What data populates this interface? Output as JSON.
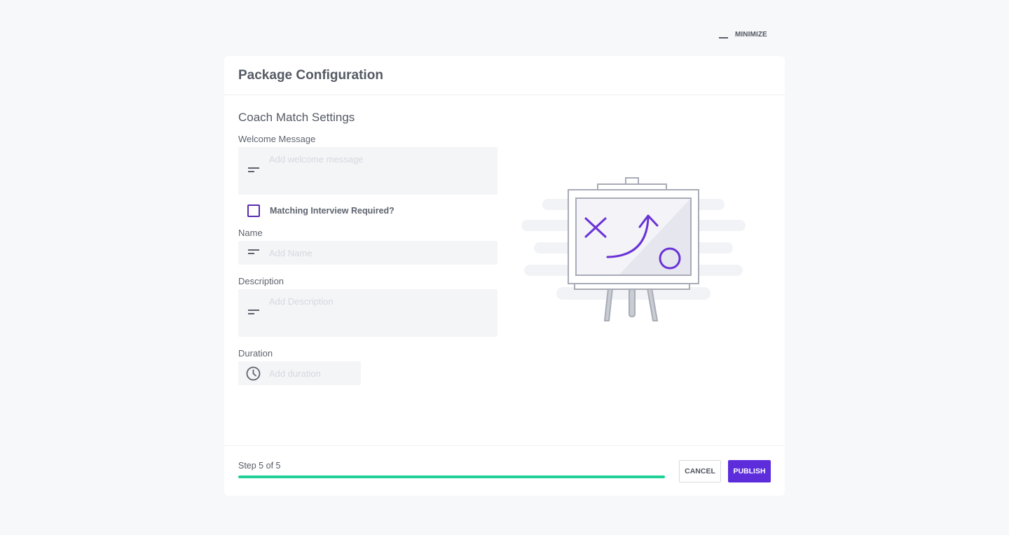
{
  "top_bar": {
    "minimize_label": "MINIMIZE"
  },
  "card": {
    "title": "Package Configuration",
    "section_title": "Coach Match Settings"
  },
  "form": {
    "welcome": {
      "label": "Welcome Message",
      "placeholder": "Add welcome message",
      "value": ""
    },
    "matching_interview": {
      "label": "Matching  Interview Required?",
      "checked": false
    },
    "name": {
      "label": "Name",
      "placeholder": "Add Name",
      "value": ""
    },
    "description": {
      "label": "Description",
      "placeholder": "Add Description",
      "value": ""
    },
    "duration": {
      "label": "Duration",
      "placeholder": "Add duration",
      "value": ""
    }
  },
  "illustration": {
    "icon": "strategy-board-illustration"
  },
  "footer": {
    "step_text": "Step 5 of 5",
    "progress": 1.0,
    "cancel_label": "CANCEL",
    "publish_label": "PUBLISH"
  },
  "colors": {
    "accent": "#5d2ddc",
    "progress": "#1fd196",
    "checkbox_border": "#5b2bb3",
    "background": "#f7f8fa"
  }
}
